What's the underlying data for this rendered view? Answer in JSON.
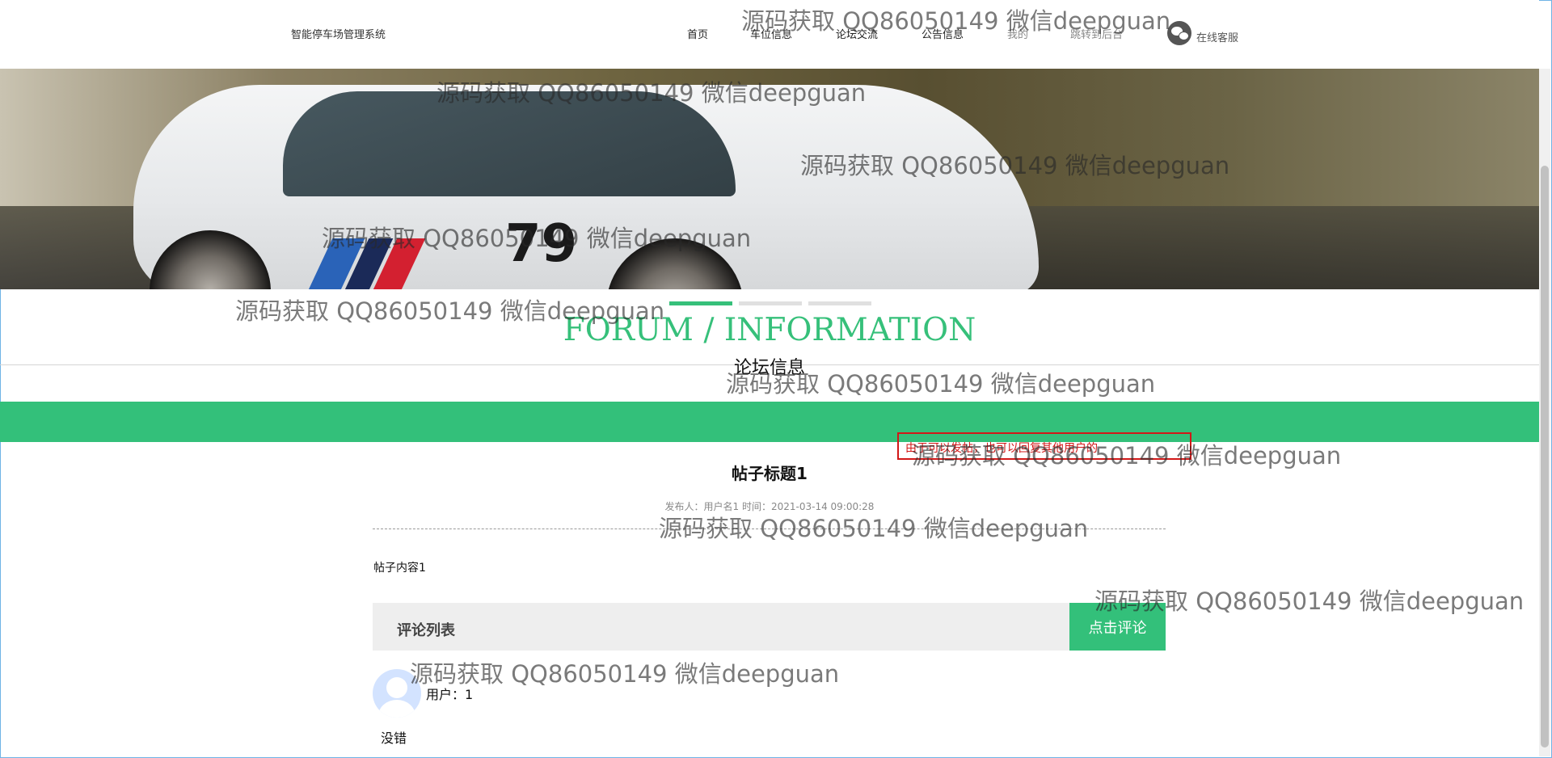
{
  "brand": "智能停车场管理系统",
  "nav": [
    {
      "label": "首页"
    },
    {
      "label": "车位信息"
    },
    {
      "label": "论坛交流"
    },
    {
      "label": "公告信息"
    },
    {
      "label": "我的"
    },
    {
      "label": "跳转到后台"
    }
  ],
  "service_label": "在线客服",
  "slider": {
    "count": 3,
    "active_index": 0
  },
  "section": {
    "title_en": "FORUM / INFORMATION",
    "title_cn": "论坛信息"
  },
  "notice": "由于可以发帖，也可以回复其他用户的",
  "post": {
    "title": "帖子标题1",
    "meta": "发布人：用户名1 时间：2021-03-14 09:00:28",
    "content": "帖子内容1"
  },
  "comments": {
    "title": "评论列表",
    "button": "点击评论",
    "items": [
      {
        "user": "用户：1",
        "text": "没错"
      }
    ]
  },
  "banner": {
    "car_number": "79"
  },
  "watermark": "源码获取 QQ86050149 微信deepguan",
  "colors": {
    "accent": "#33c07a",
    "notice": "#d21818"
  }
}
